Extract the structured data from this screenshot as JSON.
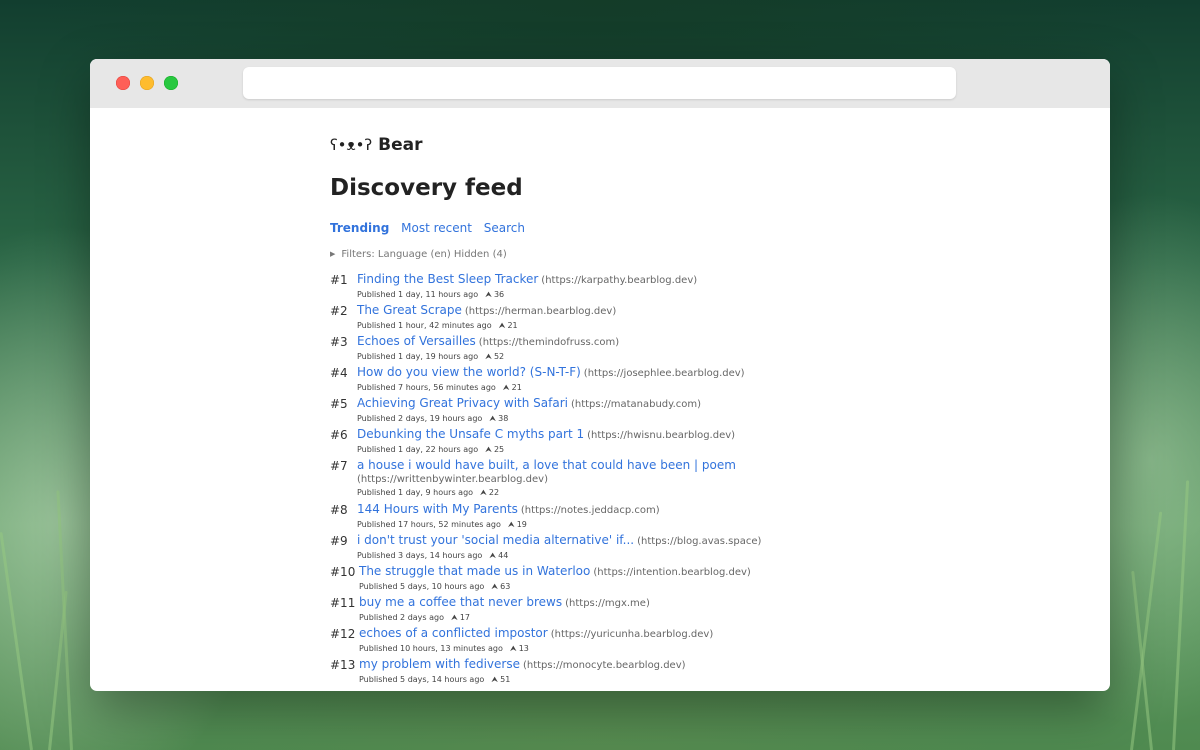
{
  "brand": {
    "face": "ʕ•ᴥ•ʔ",
    "name": "Bear"
  },
  "page_title": "Discovery feed",
  "tabs": [
    {
      "label": "Trending",
      "active": true
    },
    {
      "label": "Most recent",
      "active": false
    },
    {
      "label": "Search",
      "active": false
    }
  ],
  "filters_label": "Filters: Language (en) Hidden (4)",
  "posts": [
    {
      "rank": "#1",
      "title": "Finding the Best Sleep Tracker",
      "domain": "(https://karpathy.bearblog.dev)",
      "published": "Published 1 day, 11 hours ago",
      "upvotes": "36"
    },
    {
      "rank": "#2",
      "title": "The Great Scrape",
      "domain": "(https://herman.bearblog.dev)",
      "published": "Published 1 hour, 42 minutes ago",
      "upvotes": "21"
    },
    {
      "rank": "#3",
      "title": "Echoes of Versailles",
      "domain": "(https://themindofruss.com)",
      "published": "Published 1 day, 19 hours ago",
      "upvotes": "52"
    },
    {
      "rank": "#4",
      "title": "How do you view the world? (S-N-T-F)",
      "domain": "(https://josephlee.bearblog.dev)",
      "published": "Published 7 hours, 56 minutes ago",
      "upvotes": "21"
    },
    {
      "rank": "#5",
      "title": "Achieving Great Privacy with Safari",
      "domain": "(https://matanabudy.com)",
      "published": "Published 2 days, 19 hours ago",
      "upvotes": "38"
    },
    {
      "rank": "#6",
      "title": "Debunking the Unsafe C myths part 1",
      "domain": "(https://hwisnu.bearblog.dev)",
      "published": "Published 1 day, 22 hours ago",
      "upvotes": "25"
    },
    {
      "rank": "#7",
      "title": "a house i would have built, a love that could have been | poem",
      "domain": "(https://writtenbywinter.bearblog.dev)",
      "published": "Published 1 day, 9 hours ago",
      "upvotes": "22"
    },
    {
      "rank": "#8",
      "title": "144 Hours with My Parents",
      "domain": "(https://notes.jeddacp.com)",
      "published": "Published 17 hours, 52 minutes ago",
      "upvotes": "19"
    },
    {
      "rank": "#9",
      "title": "i don't trust your 'social media alternative' if...",
      "domain": "(https://blog.avas.space)",
      "published": "Published 3 days, 14 hours ago",
      "upvotes": "44"
    },
    {
      "rank": "#10",
      "title": "The struggle that made us in Waterloo",
      "domain": "(https://intention.bearblog.dev)",
      "published": "Published 5 days, 10 hours ago",
      "upvotes": "63"
    },
    {
      "rank": "#11",
      "title": "buy me a coffee that never brews",
      "domain": "(https://mgx.me)",
      "published": "Published 2 days ago",
      "upvotes": "17"
    },
    {
      "rank": "#12",
      "title": "echoes of a conflicted impostor",
      "domain": "(https://yuricunha.bearblog.dev)",
      "published": "Published 10 hours, 13 minutes ago",
      "upvotes": "13"
    },
    {
      "rank": "#13",
      "title": "my problem with fediverse",
      "domain": "(https://monocyte.bearblog.dev)",
      "published": "Published 5 days, 14 hours ago",
      "upvotes": "51"
    }
  ]
}
